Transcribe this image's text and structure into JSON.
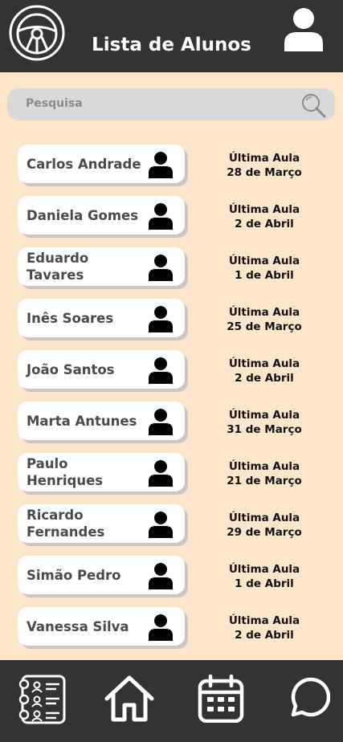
{
  "header": {
    "title": "Lista de Alunos",
    "logo_icon": "steering-wheel-icon",
    "profile_icon": "user-icon"
  },
  "search": {
    "placeholder": "Pesquisa",
    "icon": "search-icon"
  },
  "students": [
    {
      "name": "Carlos Andrade",
      "last_label": "Última Aula",
      "last_date": "28 de Março"
    },
    {
      "name": "Daniela Gomes",
      "last_label": "Última Aula",
      "last_date": "2 de Abril"
    },
    {
      "name": "Eduardo Tavares",
      "last_label": "Última Aula",
      "last_date": "1 de Abril"
    },
    {
      "name": "Inês Soares",
      "last_label": "Última Aula",
      "last_date": "25 de Março"
    },
    {
      "name": "João Santos",
      "last_label": "Última Aula",
      "last_date": "2 de Abril"
    },
    {
      "name": "Marta Antunes",
      "last_label": "Última Aula",
      "last_date": "31 de Março"
    },
    {
      "name": "Paulo Henriques",
      "last_label": "Última Aula",
      "last_date": "21 de Março"
    },
    {
      "name": "Ricardo Fernandes",
      "last_label": "Última Aula",
      "last_date": "29 de Março"
    },
    {
      "name": "Simão Pedro",
      "last_label": "Última Aula",
      "last_date": "1 de Abril"
    },
    {
      "name": "Vanessa Silva",
      "last_label": "Última Aula",
      "last_date": "2 de Abril"
    }
  ],
  "navbar": {
    "items": [
      "student-list-icon",
      "home-icon",
      "calendar-icon",
      "chat-icon"
    ]
  },
  "colors": {
    "header_bg": "#333333",
    "page_bg": "#fde7cb",
    "search_bg": "#d9d9d9",
    "card_bg": "#ffffff",
    "card_shadow": "#cfc3c9"
  }
}
